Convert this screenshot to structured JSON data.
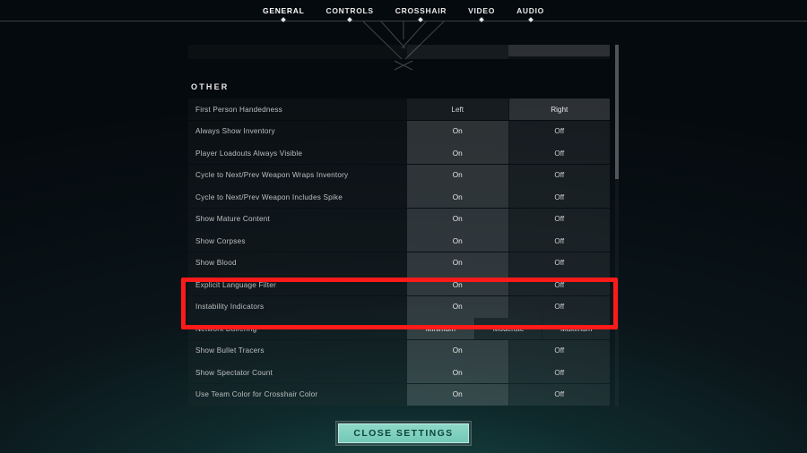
{
  "nav": {
    "tabs": [
      {
        "label": "GENERAL",
        "active": true
      },
      {
        "label": "CONTROLS",
        "active": false
      },
      {
        "label": "CROSSHAIR",
        "active": false
      },
      {
        "label": "VIDEO",
        "active": false
      },
      {
        "label": "AUDIO",
        "active": false
      }
    ]
  },
  "section_other": "OTHER",
  "rows": [
    {
      "label": "First Person Handedness",
      "type": "two",
      "options": [
        "Left",
        "Right"
      ],
      "selected": 1
    },
    {
      "label": "Always Show Inventory",
      "type": "two",
      "options": [
        "On",
        "Off"
      ],
      "selected": 0
    },
    {
      "label": "Player Loadouts Always Visible",
      "type": "two",
      "options": [
        "On",
        "Off"
      ],
      "selected": 0
    },
    {
      "label": "Cycle to Next/Prev Weapon Wraps Inventory",
      "type": "two",
      "options": [
        "On",
        "Off"
      ],
      "selected": 0
    },
    {
      "label": "Cycle to Next/Prev Weapon Includes Spike",
      "type": "two",
      "options": [
        "On",
        "Off"
      ],
      "selected": 0
    },
    {
      "label": "Show Mature Content",
      "type": "two",
      "options": [
        "On",
        "Off"
      ],
      "selected": 0
    },
    {
      "label": "Show Corpses",
      "type": "two",
      "options": [
        "On",
        "Off"
      ],
      "selected": 0
    },
    {
      "label": "Show Blood",
      "type": "two",
      "options": [
        "On",
        "Off"
      ],
      "selected": 0
    },
    {
      "label": "Explicit Language Filter",
      "type": "two",
      "options": [
        "On",
        "Off"
      ],
      "selected": 0
    },
    {
      "label": "Instability Indicators",
      "type": "two",
      "options": [
        "On",
        "Off"
      ],
      "selected": 0
    },
    {
      "label": "Network Buffering",
      "type": "three",
      "options": [
        "Minimum",
        "Moderate",
        "Maximum"
      ],
      "selected": 0
    },
    {
      "label": "Show Bullet Tracers",
      "type": "two",
      "options": [
        "On",
        "Off"
      ],
      "selected": 0
    },
    {
      "label": "Show Spectator Count",
      "type": "two",
      "options": [
        "On",
        "Off"
      ],
      "selected": 0
    },
    {
      "label": "Use Team Color for Crosshair Color",
      "type": "two",
      "options": [
        "On",
        "Off"
      ],
      "selected": 0
    }
  ],
  "close_label": "CLOSE SETTINGS",
  "highlight_rows": [
    6,
    7
  ]
}
